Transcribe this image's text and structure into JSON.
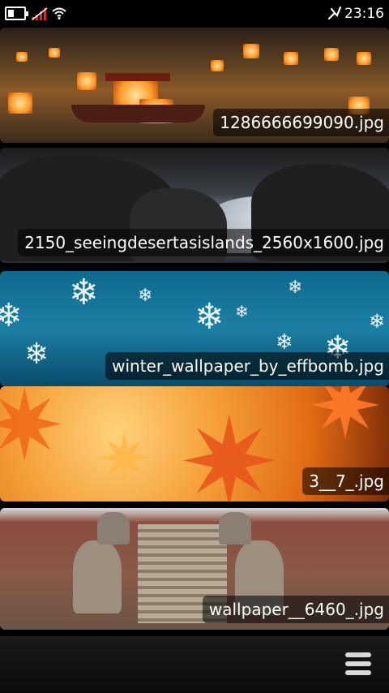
{
  "status_bar": {
    "time": "23:16",
    "icons": [
      "battery-icon",
      "signal-icon",
      "wifi-icon",
      "usb-icon"
    ]
  },
  "gallery": {
    "items": [
      {
        "caption": "1286666699090.jpg"
      },
      {
        "caption": "2150_seeingdesertasislands_2560x1600.jpg"
      },
      {
        "caption": "winter_wallpaper_by_effbomb.jpg"
      },
      {
        "caption": "3__7_.jpg"
      },
      {
        "caption": "wallpaper__6460_.jpg"
      }
    ]
  },
  "toolbar": {
    "icons": [
      "menu-icon"
    ]
  }
}
